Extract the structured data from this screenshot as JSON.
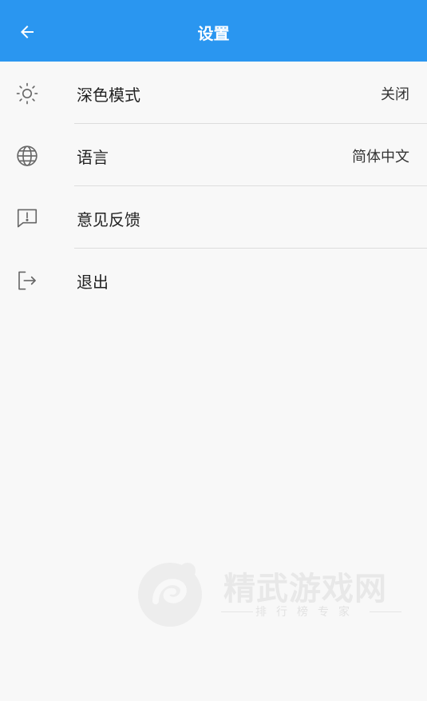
{
  "appbar": {
    "title": "设置",
    "back_icon": "arrow-left-icon",
    "color": "#2a96f0"
  },
  "settings": [
    {
      "id": "dark-mode",
      "icon": "sun-icon",
      "label": "深色模式",
      "value": "关闭"
    },
    {
      "id": "language",
      "icon": "globe-icon",
      "label": "语言",
      "value": "简体中文"
    },
    {
      "id": "feedback",
      "icon": "feedback-icon",
      "label": "意见反馈",
      "value": ""
    },
    {
      "id": "logout",
      "icon": "logout-icon",
      "label": "退出",
      "value": ""
    }
  ],
  "watermark": {
    "title": "精武游戏网",
    "subtitle": "排行榜专家"
  }
}
